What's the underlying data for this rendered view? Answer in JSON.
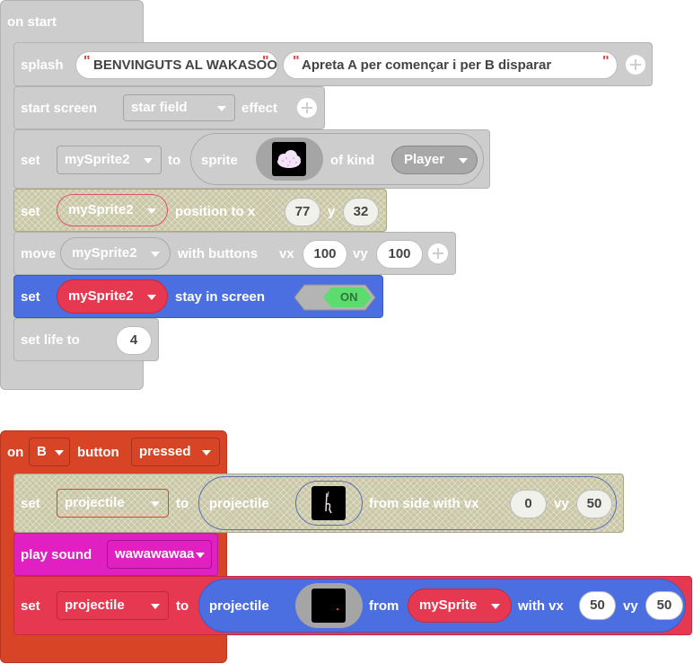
{
  "on_start": {
    "header": "on start",
    "splash": {
      "label": "splash",
      "title": "BENVINGUTS AL WAKASOOUNDS",
      "subtitle": "Apreta A per començar i per B disparar"
    },
    "start_screen": {
      "label": "start screen",
      "effect": "star field",
      "suffix": "effect"
    },
    "set_sprite": {
      "label": "set",
      "variable": "mySprite2",
      "to": "to",
      "sprite_label": "sprite",
      "of_kind": "of kind",
      "kind": "Player"
    },
    "set_position": {
      "label": "set",
      "variable": "mySprite2",
      "text": "position to x",
      "x": "77",
      "y_label": "y",
      "y": "32"
    },
    "move": {
      "label": "move",
      "variable": "mySprite2",
      "text": "with buttons",
      "vx_label": "vx",
      "vx": "100",
      "vy_label": "vy",
      "vy": "100"
    },
    "stay": {
      "label": "set",
      "variable": "mySprite2",
      "text": "stay in screen",
      "toggle": "ON"
    },
    "life": {
      "label": "set life to",
      "value": "4"
    }
  },
  "on_button": {
    "on_label": "on",
    "button": "B",
    "button_label": "button",
    "event": "pressed",
    "projectile1": {
      "label": "set",
      "variable": "projectile",
      "to": "to",
      "proj_label": "projectile",
      "text": "from side with vx",
      "vx": "0",
      "vy_label": "vy",
      "vy": "50"
    },
    "play": {
      "label": "play sound",
      "sound": "wawawawaa"
    },
    "projectile2": {
      "label": "set",
      "variable": "projectile",
      "to": "to",
      "proj_label": "projectile",
      "from": "from",
      "from_sprite": "mySprite",
      "text": "with vx",
      "vx": "50",
      "vy_label": "vy",
      "vy": "50"
    }
  },
  "colors": {
    "grey": "#cdcdcd",
    "blue": "#4b6fe0",
    "red": "#e63850",
    "orange": "#d84426",
    "magenta": "#e020c0",
    "green": "#5cdb6e"
  },
  "icons": [
    "plus-icon",
    "caret-down-icon",
    "cloud-sprite-icon",
    "projectile-sprite-icon"
  ]
}
